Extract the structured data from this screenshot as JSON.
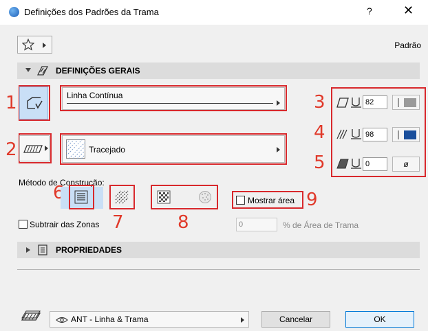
{
  "window": {
    "title": "Definições dos Padrões da Trama",
    "help": "?",
    "close": "✕"
  },
  "favorites": {
    "preset_label": "Padrão"
  },
  "general_section": {
    "label": "DEFINIÇÕES GERAIS"
  },
  "line_type": {
    "value": "Linha Contínua"
  },
  "fill_type": {
    "value": "Tracejado"
  },
  "pens": {
    "line_pen": "82",
    "background_pen": "98",
    "background_swatch_color": "#1a4f9c",
    "cut_fill_pen": "0",
    "empty_symbol": "ø"
  },
  "construction": {
    "label": "Método de Construção:",
    "show_area_label": "Mostrar área",
    "show_area_checked": false
  },
  "zones": {
    "subtract_label": "Subtrair das Zonas",
    "subtract_checked": false,
    "area_percent_value": "0",
    "area_percent_label": "% de Área de Trama"
  },
  "properties_section": {
    "label": "PROPRIEDADES"
  },
  "footer": {
    "layer_value": "ANT - Linha & Trama",
    "cancel_label": "Cancelar",
    "ok_label": "OK"
  },
  "callouts": [
    "1",
    "2",
    "3",
    "4",
    "5",
    "6",
    "7",
    "8",
    "9"
  ],
  "colors": {
    "callout_red": "#d8282c",
    "selection_blue": "#c9dff6",
    "ok_border": "#0078d7"
  }
}
